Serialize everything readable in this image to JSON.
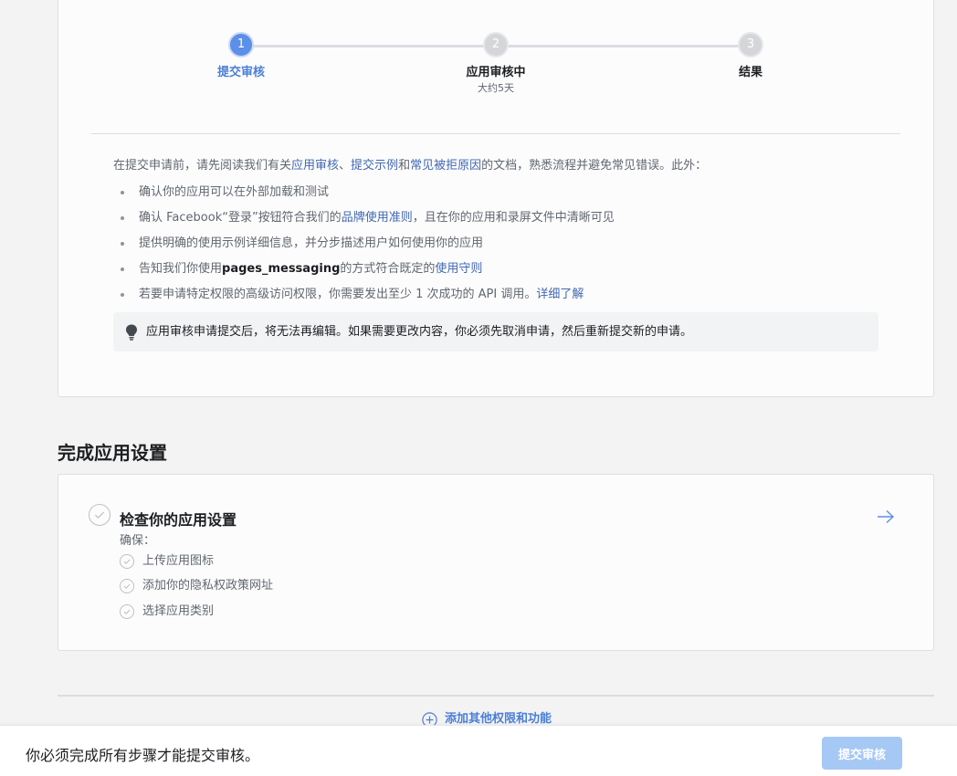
{
  "stepper": {
    "steps": [
      {
        "number": "1",
        "label": "提交审核",
        "sub": ""
      },
      {
        "number": "2",
        "label": "应用审核中",
        "sub": "大约5天"
      },
      {
        "number": "3",
        "label": "结果",
        "sub": ""
      }
    ]
  },
  "intro": {
    "prefix": "在提交申请前，请先阅读我们有关",
    "link1": "应用审核",
    "sep1": "、",
    "link2": "提交示例",
    "sep2": "和",
    "link3": "常见被拒原因",
    "suffix": "的文档，熟悉流程并避免常见错误。此外："
  },
  "checklist": {
    "item1": "确认你的应用可以在外部加载和测试",
    "item2_prefix": "确认 Facebook“登录”按钮符合我们的",
    "item2_link": "品牌使用准则",
    "item2_suffix": "，且在你的应用和录屏文件中清晰可见",
    "item3": "提供明确的使用示例详细信息，并分步描述用户如何使用你的应用",
    "item4_prefix": "告知我们你使用",
    "item4_bold": "pages_messaging",
    "item4_mid": "的方式符合既定的",
    "item4_link": "使用守则",
    "item5_prefix": "若要申请特定权限的高级访问权限，你需要发出至少 1 次成功的 API 调用。",
    "item5_link": "详细了解"
  },
  "notice": {
    "icon": "lightbulb-icon",
    "text": "应用审核申请提交后，将无法再编辑。如果需要更改内容，你必须先取消申请，然后重新提交新的申请。"
  },
  "section": {
    "title": "完成应用设置"
  },
  "settings": {
    "title": "检查你的应用设置",
    "ensure": "确保：",
    "items": [
      "上传应用图标",
      "添加你的隐私权政策网址",
      "选择应用类别"
    ]
  },
  "add_more": {
    "label": "添加其他权限和功能"
  },
  "footer": {
    "message": "你必须完成所有步骤才能提交审核。",
    "submit_label": "提交审核"
  },
  "colors": {
    "accent": "#5b8fe8",
    "link": "#4267b2",
    "button_disabled": "#a6c8f5"
  }
}
